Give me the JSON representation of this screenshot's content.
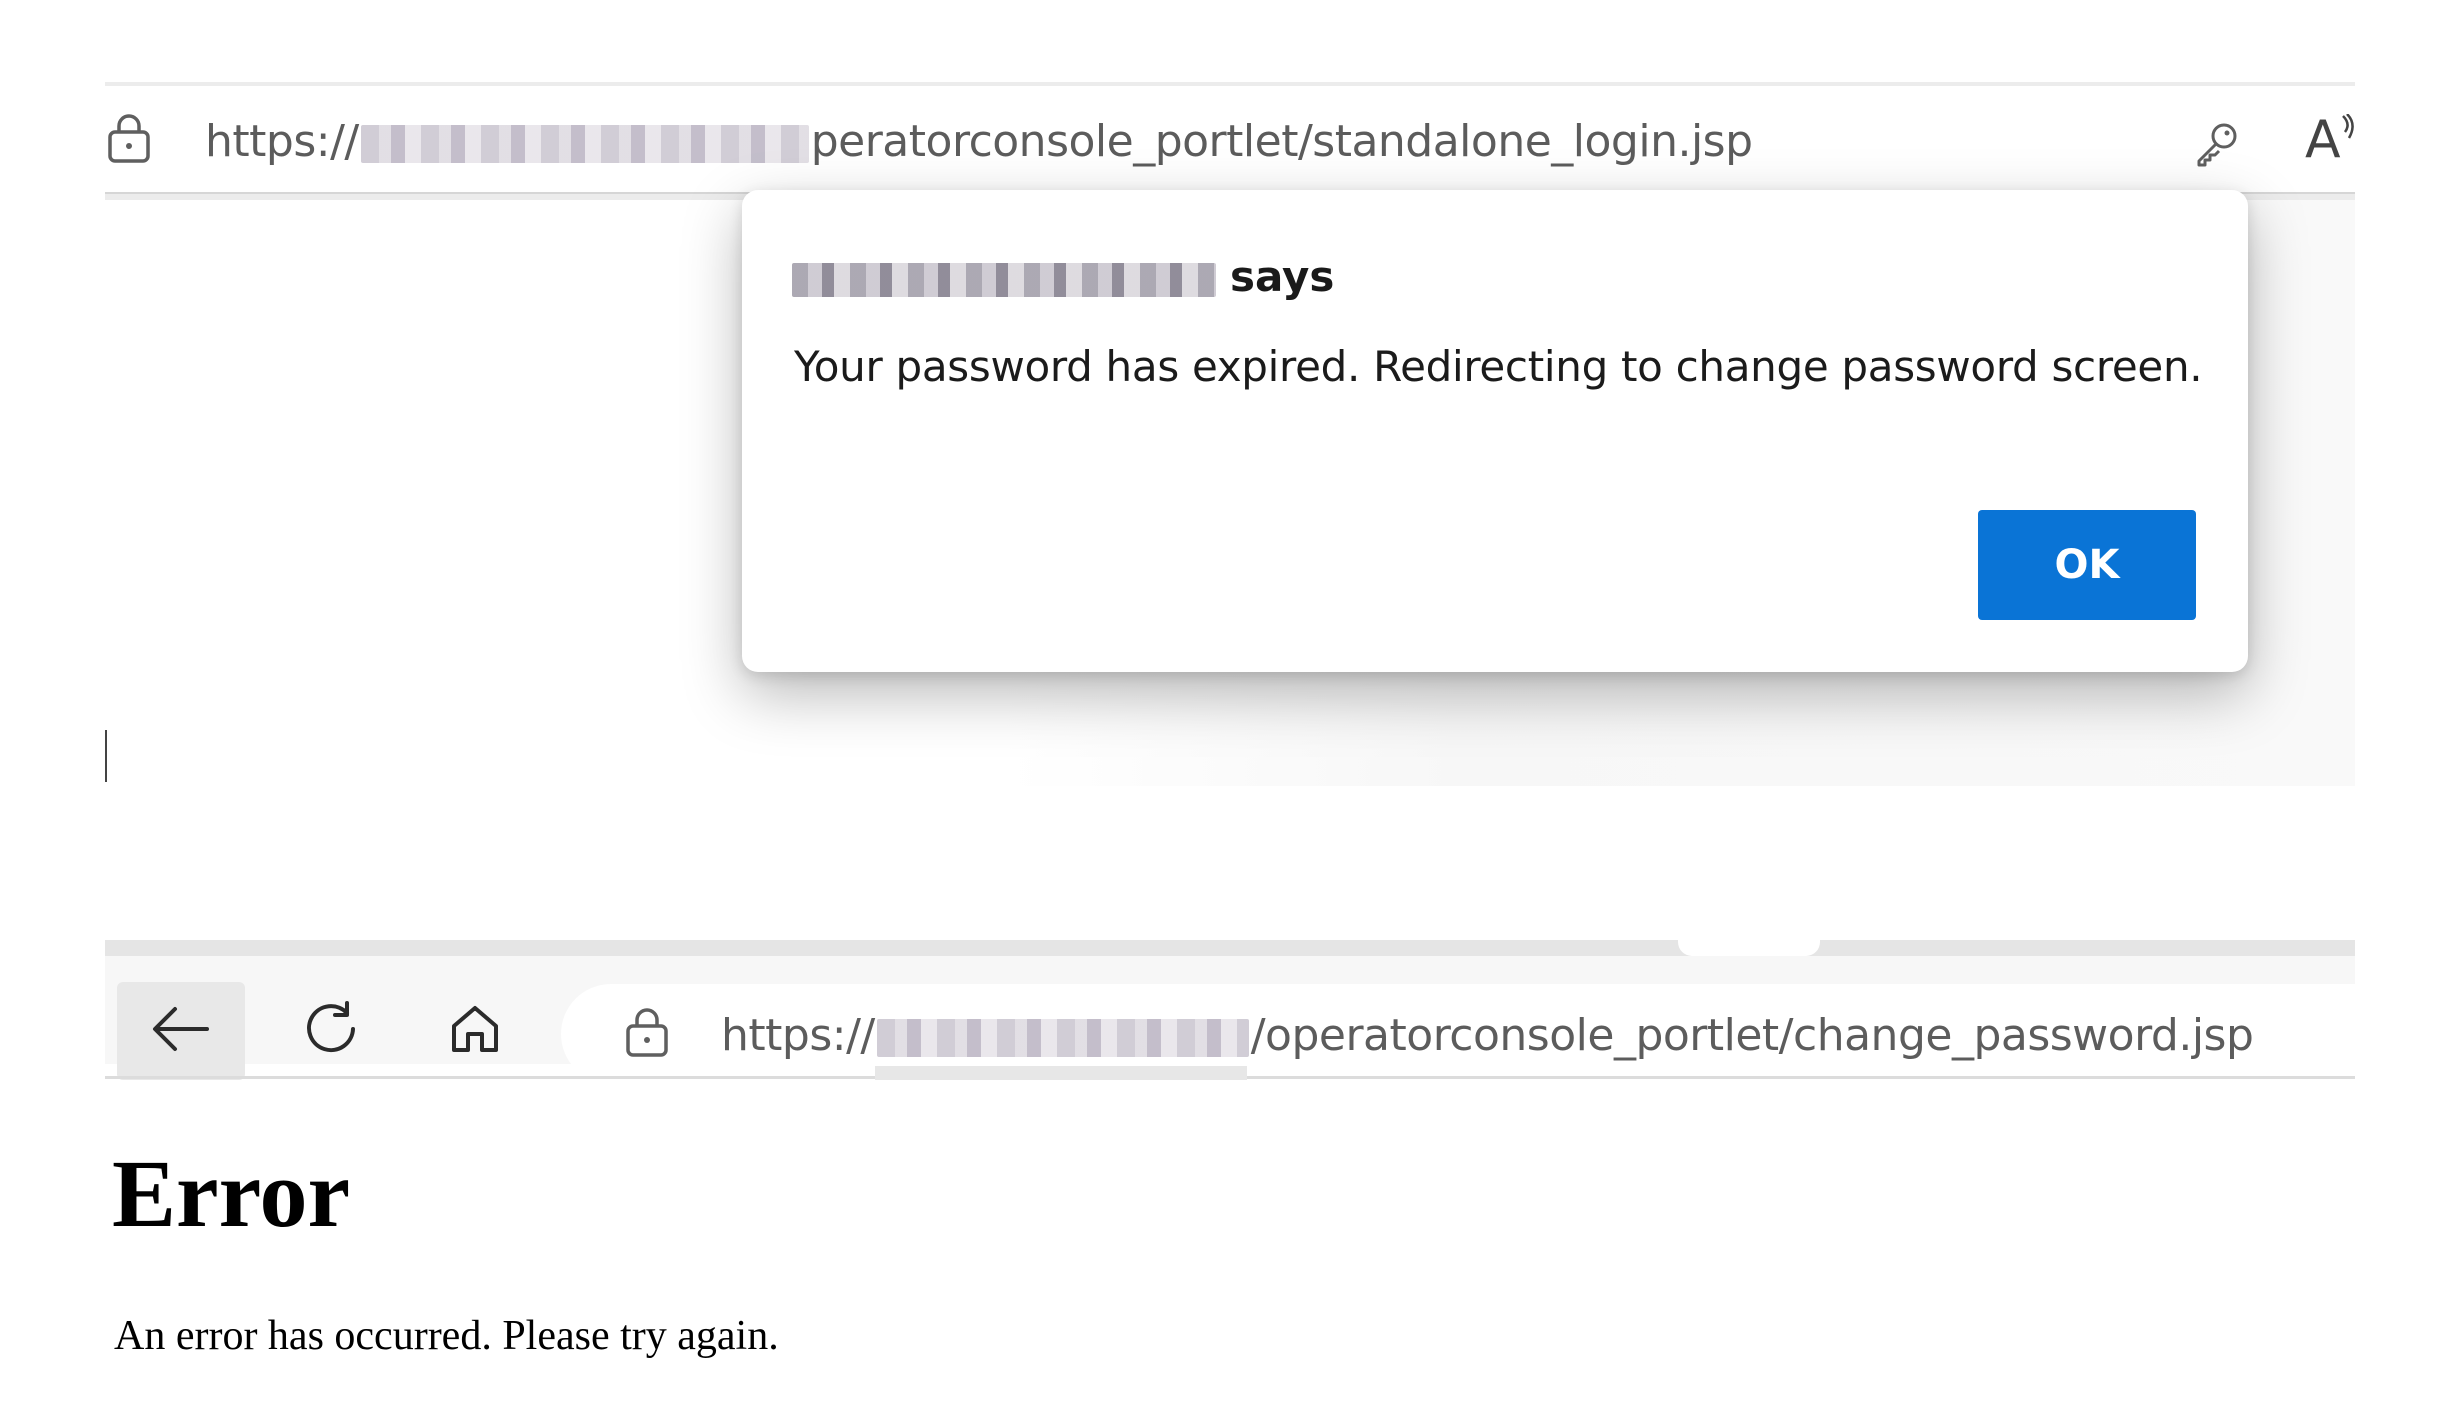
{
  "top_browser": {
    "url_prefix": "https://",
    "url_suffix": "peratorconsole_portlet/standalone_login.jsp",
    "icons": [
      "lock-icon",
      "key-icon",
      "read-aloud-icon"
    ],
    "read_aloud_glyph": "A"
  },
  "dialog": {
    "title_suffix": "says",
    "message": "Your password has expired. Redirecting to change password screen.",
    "ok_label": "OK",
    "accent_color": "#0a74d6"
  },
  "bottom_browser": {
    "url_prefix": "https://",
    "url_suffix": "/operatorconsole_portlet/change_password.jsp",
    "icons": [
      "back-arrow-icon",
      "refresh-icon",
      "home-icon",
      "lock-icon"
    ]
  },
  "error_page": {
    "heading": "Error",
    "message": "An error has occurred. Please try again."
  }
}
